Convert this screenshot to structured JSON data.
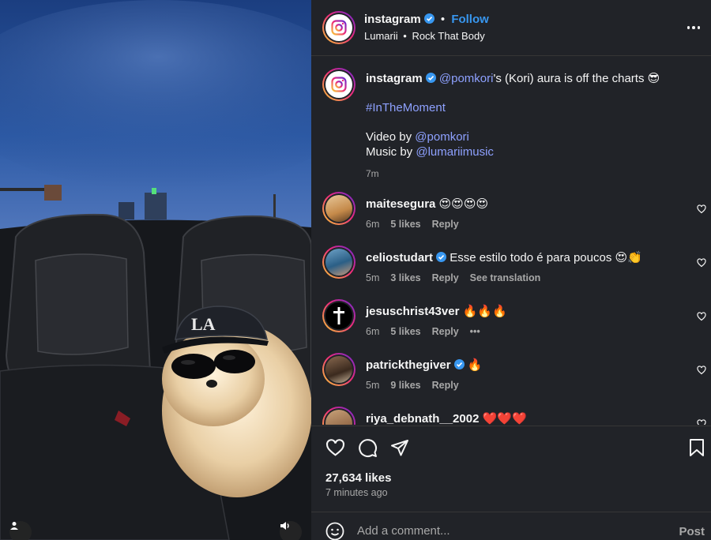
{
  "post": {
    "author": "instagram",
    "follow_label": "Follow",
    "separator": "•",
    "music_artist": "Lumarii",
    "music_dot": "•",
    "music_track": "Rock That Body"
  },
  "caption": {
    "author": "instagram",
    "mention": "@pomkori",
    "text": "'s (Kori) aura is off the charts 😎",
    "hashtag": "#InTheMoment",
    "video_by_label": "Video by",
    "video_by": "@pomkori",
    "music_by_label": "Music by",
    "music_by": "@lumariimusic",
    "time": "7m"
  },
  "comments": [
    {
      "user": "maitesegura",
      "verified": false,
      "text": "😍😍😍😍",
      "time": "6m",
      "likes": "5 likes",
      "reply": "Reply",
      "extra": ""
    },
    {
      "user": "celiostudart",
      "verified": true,
      "text": "Esse estilo todo é para poucos 😍👏",
      "time": "5m",
      "likes": "3 likes",
      "reply": "Reply",
      "extra": "See translation"
    },
    {
      "user": "jesuschrist43ver",
      "verified": false,
      "text": "🔥🔥🔥",
      "time": "6m",
      "likes": "5 likes",
      "reply": "Reply",
      "extra": "•••"
    },
    {
      "user": "patrickthegiver",
      "verified": true,
      "text": "🔥",
      "time": "5m",
      "likes": "9 likes",
      "reply": "Reply",
      "extra": ""
    },
    {
      "user": "riya_debnath__2002",
      "verified": false,
      "text": "❤️❤️❤️",
      "time": "",
      "likes": "",
      "reply": "",
      "extra": ""
    }
  ],
  "stats": {
    "likes": "27,634 likes",
    "ago": "7 minutes ago"
  },
  "comment_input": {
    "placeholder": "Add a comment...",
    "post_label": "Post"
  },
  "icons": {
    "like": "heart-icon",
    "comment": "comment-icon",
    "share": "share-icon",
    "save": "bookmark-icon",
    "emoji": "emoji-icon",
    "audio": "speaker-icon",
    "tagged": "user-icon",
    "more": "more-options-icon"
  },
  "colors": {
    "panel_bg": "#212328",
    "link": "#8ea1ff",
    "verified": "#3897f0",
    "muted": "#a8a8a8"
  }
}
